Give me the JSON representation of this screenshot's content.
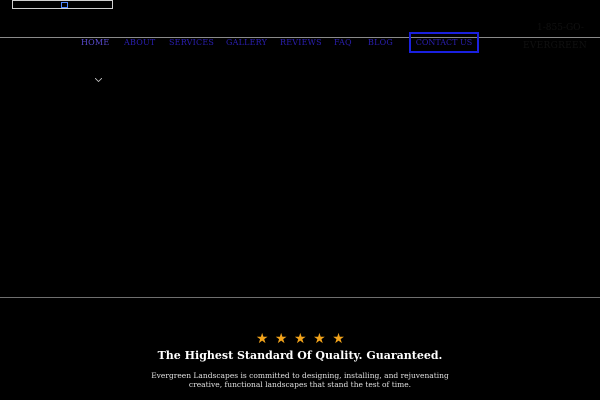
{
  "topbar": {
    "icon": "social-icon"
  },
  "nav": {
    "items": [
      {
        "label": "HOME"
      },
      {
        "label": "ABOUT"
      },
      {
        "label": "SERVICES"
      },
      {
        "label": "GALLERY"
      },
      {
        "label": "REVIEWS"
      },
      {
        "label": "FAQ"
      },
      {
        "label": "BLOG"
      }
    ],
    "contact_label": "CONTACT US"
  },
  "header": {
    "phone": "1-855-GO-",
    "brand": "EVERGREEN"
  },
  "quality": {
    "stars": [
      "★",
      "★",
      "★",
      "★",
      "★"
    ],
    "rating": 5,
    "headline": "The Highest Standard Of Quality. Guaranteed.",
    "description": "Evergreen Landscapes is committed to designing, installing, and rejuvenating creative, functional landscapes that stand the test of time."
  },
  "colors": {
    "background": "#000000",
    "nav_text": "#2b1fb3",
    "contact_border": "#1a20e0",
    "star": "#f2a31b"
  }
}
